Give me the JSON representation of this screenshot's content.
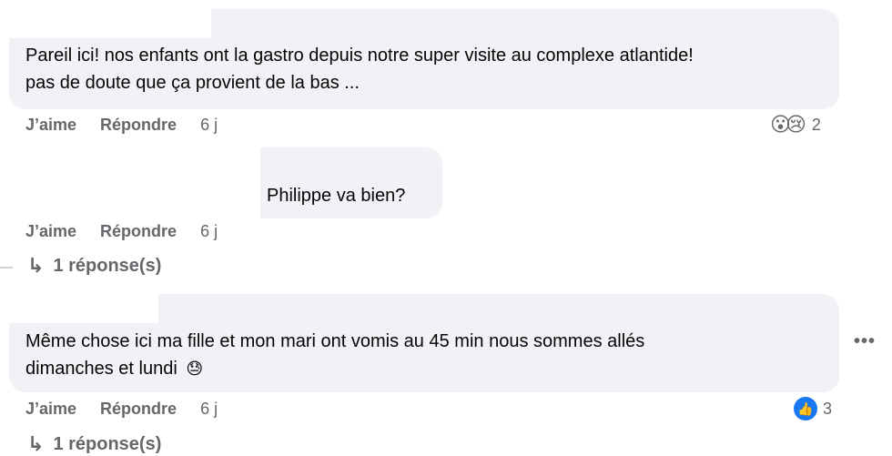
{
  "comments": [
    {
      "text_line1": "Pareil ici! nos enfants ont la gastro depuis notre super visite au complexe atlantide!",
      "text_line2": "pas de doute que ça provient de la bas ...",
      "like": "J’aime",
      "reply": "Répondre",
      "time": "6 j",
      "reaction_icons": [
        "😮",
        "😢"
      ],
      "reaction_count": "2"
    },
    {
      "text": "Philippe va bien?",
      "like": "J’aime",
      "reply": "Répondre",
      "time": "6 j",
      "replies": "1 réponse(s)"
    },
    {
      "text_line1": "Même chose ici ma fille et mon mari ont vomis au 45 min nous sommes allés",
      "text_line2": "dimanches et lundi",
      "emoji": "😓",
      "like": "J’aime",
      "reply": "Répondre",
      "time": "6 j",
      "reaction_icons": [
        "👍"
      ],
      "reaction_count": "3",
      "more": "•••"
    }
  ],
  "partial_reply_link": "1 réponse(s)"
}
